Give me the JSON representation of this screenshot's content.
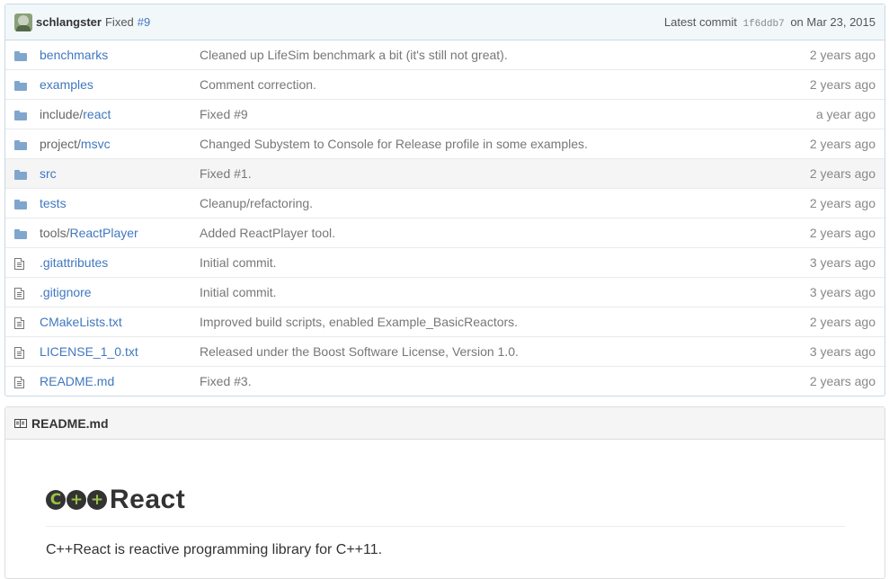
{
  "commit": {
    "author": "schlangster",
    "message": "Fixed",
    "issue": "#9",
    "latest_label": "Latest commit",
    "sha": "1f6ddb7",
    "date_text": "on Mar 23, 2015"
  },
  "files": [
    {
      "type": "folder",
      "dir": "",
      "name": "benchmarks",
      "message": "Cleaned up LifeSim benchmark a bit (it's still not great).",
      "age": "2 years ago"
    },
    {
      "type": "folder",
      "dir": "",
      "name": "examples",
      "message": "Comment correction.",
      "age": "2 years ago"
    },
    {
      "type": "folder",
      "dir": "include/",
      "name": "react",
      "message": "Fixed #9",
      "age": "a year ago"
    },
    {
      "type": "folder",
      "dir": "project/",
      "name": "msvc",
      "message": "Changed Subystem to Console for Release profile in some examples.",
      "age": "2 years ago"
    },
    {
      "type": "folder",
      "dir": "",
      "name": "src",
      "message": "Fixed #1.",
      "age": "2 years ago"
    },
    {
      "type": "folder",
      "dir": "",
      "name": "tests",
      "message": "Cleanup/refactoring.",
      "age": "2 years ago"
    },
    {
      "type": "folder",
      "dir": "tools/",
      "name": "ReactPlayer",
      "message": "Added ReactPlayer tool.",
      "age": "2 years ago"
    },
    {
      "type": "file",
      "dir": "",
      "name": ".gitattributes",
      "message": "Initial commit.",
      "age": "3 years ago"
    },
    {
      "type": "file",
      "dir": "",
      "name": ".gitignore",
      "message": "Initial commit.",
      "age": "3 years ago"
    },
    {
      "type": "file",
      "dir": "",
      "name": "CMakeLists.txt",
      "message": "Improved build scripts, enabled Example_BasicReactors.",
      "age": "2 years ago"
    },
    {
      "type": "file",
      "dir": "",
      "name": "LICENSE_1_0.txt",
      "message": "Released under the Boost Software License, Version 1.0.",
      "age": "3 years ago"
    },
    {
      "type": "file",
      "dir": "",
      "name": "README.md",
      "message": "Fixed #3.",
      "age": "2 years ago"
    }
  ],
  "readme": {
    "header": "README.md",
    "logo_glyphs": [
      "C",
      "+",
      "+"
    ],
    "logo_word": "React",
    "intro": "C++React is reactive programming library for C++11."
  },
  "colors": {
    "link": "#4078c0",
    "folder": "#80a6cd",
    "logo_green": "#98c147",
    "highlight_row": "#f5f5f5"
  }
}
